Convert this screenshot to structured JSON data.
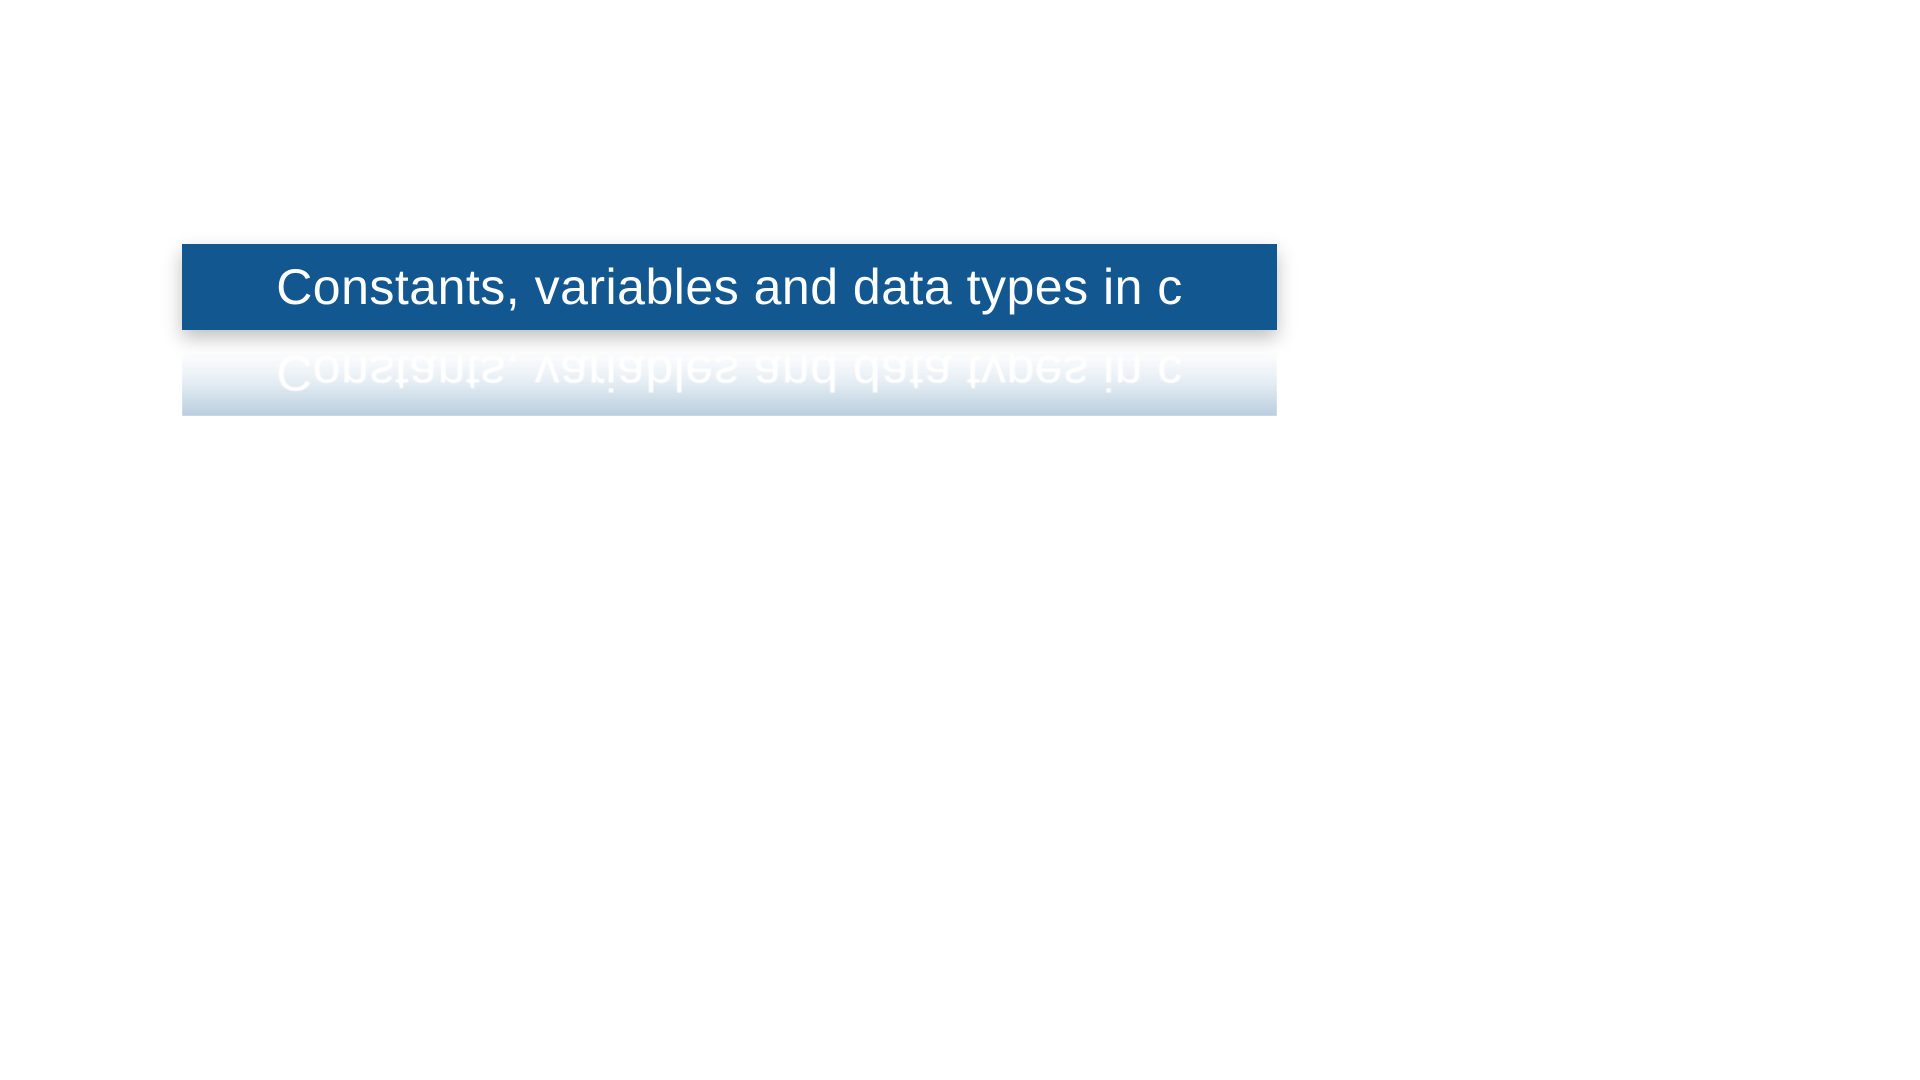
{
  "slide": {
    "title": "Constants, variables and data types in c"
  }
}
